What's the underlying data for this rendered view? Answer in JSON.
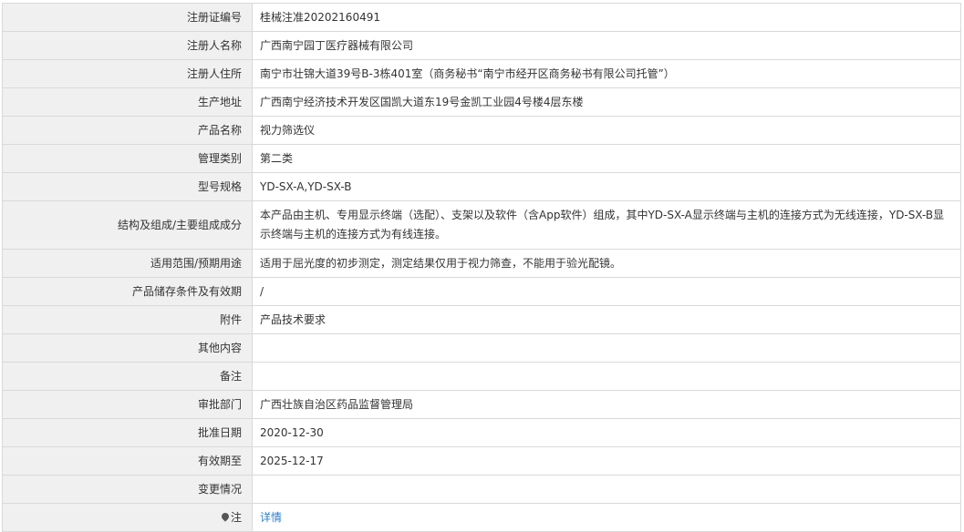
{
  "rows": [
    {
      "label": "注册证编号",
      "value": "桂械注准20202160491"
    },
    {
      "label": "注册人名称",
      "value": "广西南宁园丁医疗器械有限公司"
    },
    {
      "label": "注册人住所",
      "value": "南宁市壮锦大道39号B-3栋401室（商务秘书“南宁市经开区商务秘书有限公司托管”）"
    },
    {
      "label": "生产地址",
      "value": "广西南宁经济技术开发区国凯大道东19号金凯工业园4号楼4层东楼"
    },
    {
      "label": "产品名称",
      "value": "视力筛选仪"
    },
    {
      "label": "管理类别",
      "value": "第二类"
    },
    {
      "label": "型号规格",
      "value": "YD-SX-A,YD-SX-B"
    },
    {
      "label": "结构及组成/主要组成成分",
      "value": "本产品由主机、专用显示终端（选配）、支架以及软件（含App软件）组成，其中YD-SX-A显示终端与主机的连接方式为无线连接，YD-SX-B显示终端与主机的连接方式为有线连接。"
    },
    {
      "label": "适用范围/预期用途",
      "value": "适用于屈光度的初步测定，测定结果仅用于视力筛查，不能用于验光配镜。"
    },
    {
      "label": "产品储存条件及有效期",
      "value": "/"
    },
    {
      "label": "附件",
      "value": "产品技术要求"
    },
    {
      "label": "其他内容",
      "value": ""
    },
    {
      "label": "备注",
      "value": ""
    },
    {
      "label": "审批部门",
      "value": "广西壮族自治区药品监督管理局"
    },
    {
      "label": "批准日期",
      "value": "2020-12-30"
    },
    {
      "label": "有效期至",
      "value": "2025-12-17"
    },
    {
      "label": "变更情况",
      "value": ""
    }
  ],
  "note_row": {
    "icon": "note-pin-icon",
    "label": "注",
    "link": "详情"
  }
}
